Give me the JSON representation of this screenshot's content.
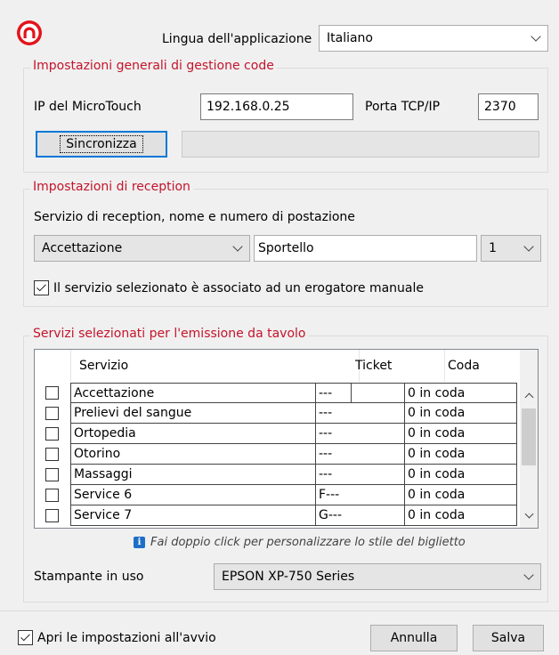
{
  "colors": {
    "accent_red": "#c4142b",
    "info_blue": "#1e6ec8"
  },
  "language": {
    "label": "Lingua dell'applicazione",
    "value": "Italiano"
  },
  "queue_settings": {
    "legend": "Impostazioni generali di gestione code",
    "ip_label": "IP del MicroTouch",
    "ip_value": "192.168.0.25",
    "port_label": "Porta TCP/IP",
    "port_value": "2370",
    "sync_button": "Sincronizza",
    "sync_status": ""
  },
  "reception": {
    "legend": "Impostazioni di reception",
    "description": "Servizio di reception, nome e numero di postazione",
    "service_value": "Accettazione",
    "desk_name": "Sportello",
    "desk_number": "1",
    "manual_checkbox_label": "Il servizio selezionato è associato ad un erogatore manuale",
    "manual_checked": true
  },
  "table_services": {
    "legend": "Servizi selezionati per l'emissione da tavolo",
    "columns": [
      "Servizio",
      "Ticket",
      "Coda"
    ],
    "rows": [
      {
        "service": "Accettazione",
        "ticket": "---",
        "queue": "0 in coda",
        "checked": false
      },
      {
        "service": "Prelievi del sangue",
        "ticket": "---",
        "queue": "0 in coda",
        "checked": false
      },
      {
        "service": "Ortopedia",
        "ticket": "---",
        "queue": "0 in coda",
        "checked": false
      },
      {
        "service": "Otorino",
        "ticket": "---",
        "queue": "0 in coda",
        "checked": false
      },
      {
        "service": "Massaggi",
        "ticket": "---",
        "queue": "0 in coda",
        "checked": false
      },
      {
        "service": "Service 6",
        "ticket": "F---",
        "queue": "0 in coda",
        "checked": false
      },
      {
        "service": "Service 7",
        "ticket": "G---",
        "queue": "0 in coda",
        "checked": false
      }
    ],
    "hint": "Fai doppio click per personalizzare lo stile del biglietto",
    "printer_label": "Stampante in uso",
    "printer_value": "EPSON XP-750 Series"
  },
  "footer": {
    "open_on_start_label": "Apri le impostazioni all'avvio",
    "open_on_start_checked": true,
    "cancel_button": "Annulla",
    "save_button": "Salva"
  }
}
